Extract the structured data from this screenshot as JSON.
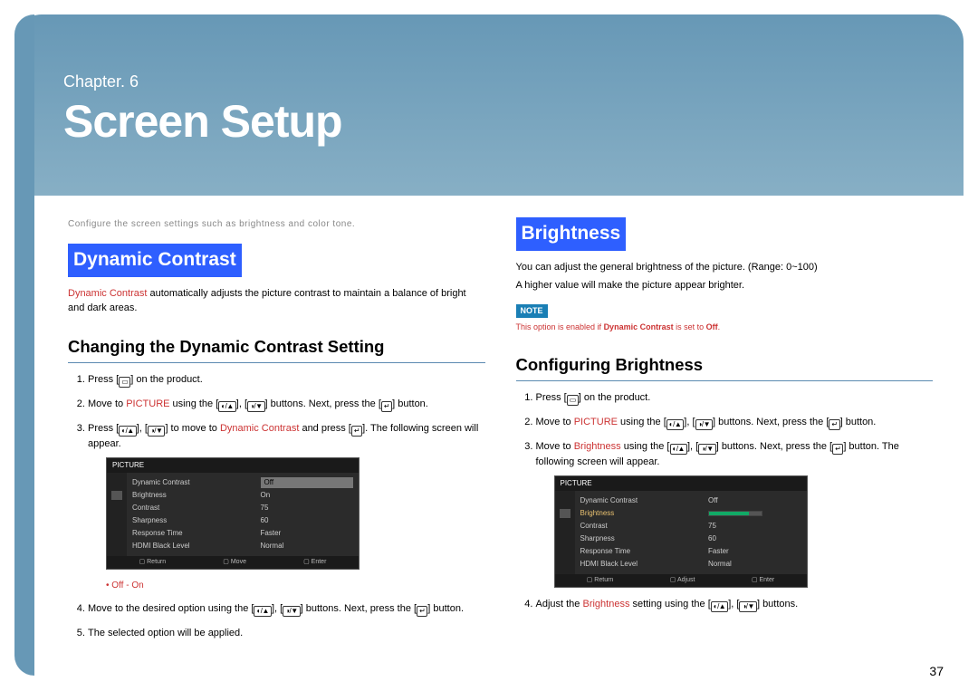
{
  "header": {
    "chapter_prefix": "Chapter. 6",
    "title": "Screen Setup"
  },
  "intro": "Configure the screen settings such as brightness and color tone.",
  "left": {
    "heading": "Dynamic Contrast",
    "term": "Dynamic Contrast",
    "desc": " automatically adjusts the picture contrast to maintain a balance of bright and dark areas.",
    "sub": "Changing the Dynamic Contrast Setting",
    "steps": {
      "s1a": "Press [",
      "s1b": "] on the product.",
      "s2a": "Move to ",
      "s2picture": "PICTURE",
      "s2b": " using the [",
      "s2c": "], [",
      "s2d": "] buttons. Next, press the [",
      "s2e": "] button.",
      "s3a": "Press [",
      "s3b": "], [",
      "s3c": "] to move to ",
      "s3term": "Dynamic Contrast",
      "s3d": " and press [",
      "s3e": "]. The following screen will appear.",
      "s4a": "Move to the desired option using the [",
      "s4b": "], [",
      "s4c": "] buttons. Next, press the [",
      "s4d": "] button.",
      "s5": "The selected option will be applied."
    },
    "options": "Off - On"
  },
  "right": {
    "heading": "Brightness",
    "desc1": "You can adjust the general brightness of the picture. (Range: 0~100)",
    "desc2": "A higher value will make the picture appear brighter.",
    "note_label": "NOTE",
    "note_a": "This option is enabled if ",
    "note_term": "Dynamic Contrast",
    "note_b": " is set to ",
    "note_off": "Off",
    "note_c": ".",
    "sub": "Configuring Brightness",
    "steps": {
      "s1a": "Press [",
      "s1b": "] on the product.",
      "s2a": "Move to ",
      "s2picture": "PICTURE",
      "s2b": " using the [",
      "s2c": "], [",
      "s2d": "] buttons. Next, press the [",
      "s2e": "] button.",
      "s3a": "Move to ",
      "s3term": "Brightness",
      "s3b": " using the [",
      "s3c": "], [",
      "s3d": "] buttons. Next, press the [",
      "s3e": "] button. The following screen will appear.",
      "s4a": "Adjust the ",
      "s4term": "Brightness",
      "s4b": " setting using the [",
      "s4c": "], [",
      "s4d": "] buttons."
    }
  },
  "osd": {
    "title": "PICTURE",
    "rows": {
      "dc": "Dynamic Contrast",
      "br": "Brightness",
      "co": "Contrast",
      "sh": "Sharpness",
      "rt": "Response Time",
      "bl": "HDMI Black Level"
    },
    "vals": {
      "dc_off": "Off",
      "dc_on": "On",
      "co": "75",
      "sh": "60",
      "rt": "Faster",
      "bl": "Normal"
    },
    "footer": {
      "ret": "Return",
      "mov": "Move",
      "adj": "Adjust",
      "ent": "Enter"
    }
  },
  "icons": {
    "menu": "▭",
    "updn1": "◐/▲",
    "updn2": "◑/▼",
    "enter": "↵"
  },
  "page": "37"
}
